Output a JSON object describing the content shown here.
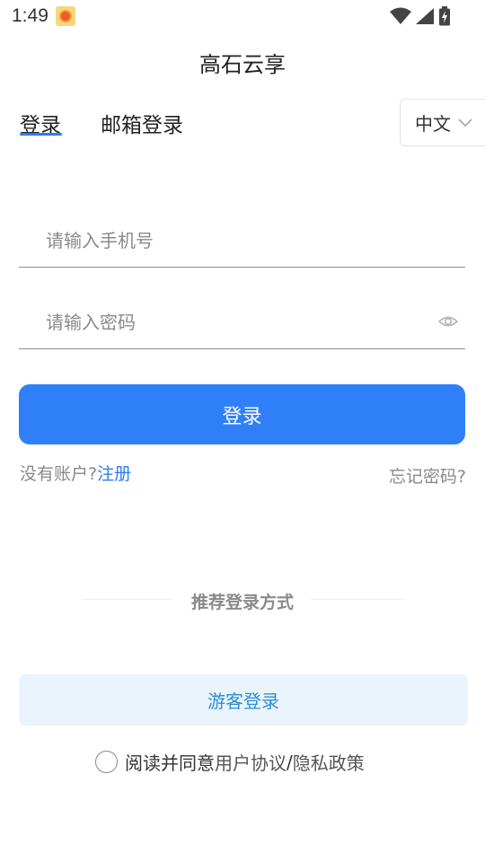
{
  "status_bar": {
    "time": "1:49",
    "notification_icon": "weather-sun-icon",
    "icons": [
      "wifi-icon",
      "signal-icon",
      "battery-charging-icon"
    ]
  },
  "app": {
    "title": "高石云享"
  },
  "tabs": {
    "active": "phone",
    "phone_label": "登录",
    "email_label": "邮箱登录"
  },
  "language": {
    "selected": "中文",
    "icon": "chevron-down-icon"
  },
  "form": {
    "phone_placeholder": "请输入手机号",
    "phone_value": "",
    "password_placeholder": "请输入密码",
    "password_value": "",
    "password_visibility_icon": "eye-icon"
  },
  "actions": {
    "login_label": "登录",
    "no_account_text": "没有账户?",
    "register_label": "注册",
    "forgot_password_label": "忘记密码?"
  },
  "recommend": {
    "label": "推荐登录方式",
    "guest_login_label": "游客登录"
  },
  "agreement": {
    "checked": false,
    "prefix": "阅读并同意",
    "user_agreement": "用户协议",
    "separator": "/",
    "privacy_policy": "隐私政策"
  },
  "colors": {
    "primary": "#2f7ff8",
    "link": "#2c7df0",
    "guest_bg": "#eaf4fd",
    "guest_text": "#2a8ed8"
  }
}
